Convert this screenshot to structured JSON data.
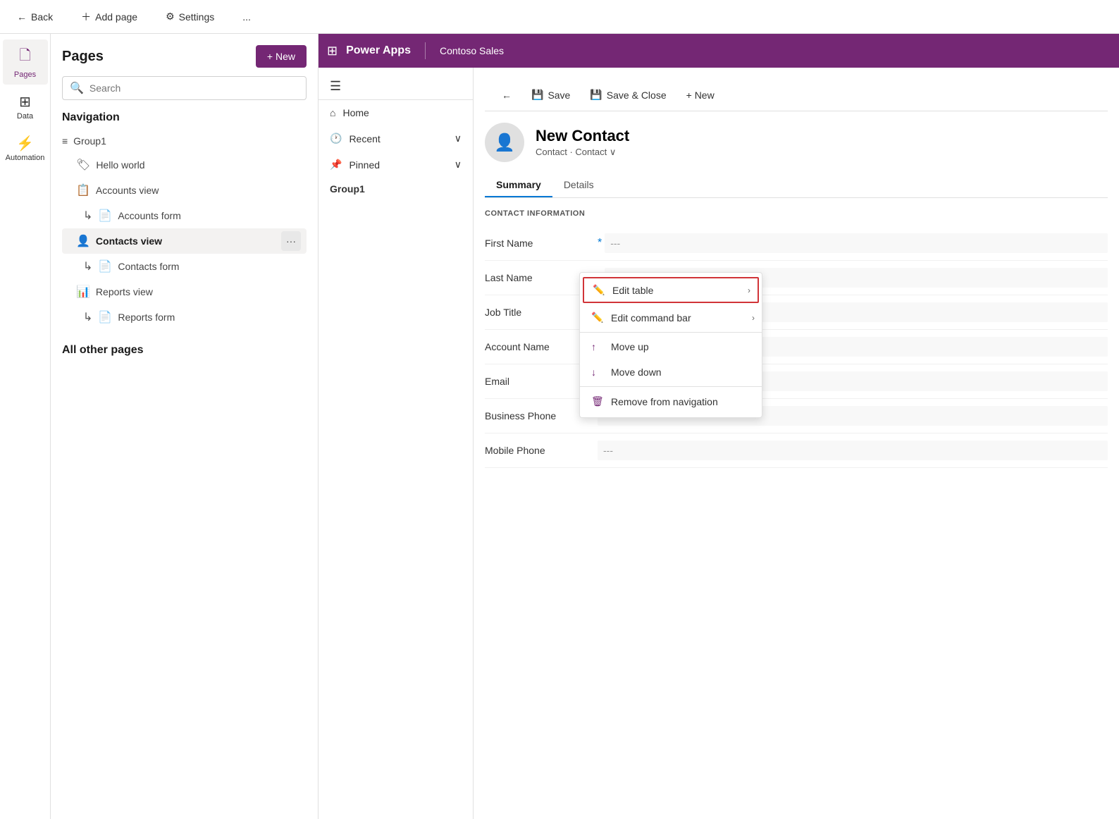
{
  "topbar": {
    "back_label": "Back",
    "add_page_label": "Add page",
    "settings_label": "Settings",
    "more_label": "..."
  },
  "icon_sidebar": {
    "items": [
      {
        "id": "pages",
        "label": "Pages",
        "icon": "🗋",
        "active": true
      },
      {
        "id": "data",
        "label": "Data",
        "icon": "⊞",
        "active": false
      },
      {
        "id": "automation",
        "label": "Automation",
        "icon": "⚡",
        "active": false
      }
    ]
  },
  "pages_panel": {
    "title": "Pages",
    "new_button": "+ New",
    "search_placeholder": "Search",
    "navigation_title": "Navigation",
    "nav_items": [
      {
        "id": "group1",
        "label": "Group1",
        "icon": "≡",
        "type": "group"
      },
      {
        "id": "hello-world",
        "label": "Hello world",
        "icon": "🏷",
        "indent": true
      },
      {
        "id": "accounts-view",
        "label": "Accounts view",
        "icon": "📋",
        "indent": true
      },
      {
        "id": "accounts-form",
        "label": "Accounts form",
        "icon": "↳📄",
        "indent": true
      },
      {
        "id": "contacts-view",
        "label": "Contacts view",
        "icon": "👤",
        "indent": true,
        "active": true
      },
      {
        "id": "contacts-form",
        "label": "Contacts form",
        "icon": "↳📄",
        "indent": true
      },
      {
        "id": "reports-view",
        "label": "Reports view",
        "icon": "📊",
        "indent": true
      },
      {
        "id": "reports-form",
        "label": "Reports form",
        "icon": "↳📄",
        "indent": true
      }
    ],
    "all_other_title": "All other pages"
  },
  "context_menu": {
    "items": [
      {
        "id": "edit-table",
        "label": "Edit table",
        "icon": "✏️",
        "has_arrow": true,
        "highlighted": true
      },
      {
        "id": "edit-command-bar",
        "label": "Edit command bar",
        "icon": "✏️",
        "has_arrow": true
      },
      {
        "id": "move-up",
        "label": "Move up",
        "icon": "↑"
      },
      {
        "id": "move-down",
        "label": "Move down",
        "icon": "↓"
      },
      {
        "id": "remove",
        "label": "Remove from navigation",
        "icon": "🗑️"
      }
    ]
  },
  "power_apps": {
    "app_icon": "⊞",
    "app_name": "Power Apps",
    "app_subtitle": "Contoso Sales",
    "nav": {
      "home": "Home",
      "recent": "Recent",
      "pinned": "Pinned",
      "group1": "Group1"
    }
  },
  "form": {
    "toolbar": {
      "back_icon": "←",
      "save_label": "Save",
      "save_close_label": "Save & Close",
      "new_label": "+ New"
    },
    "contact": {
      "title": "New Contact",
      "subtitle1": "Contact",
      "subtitle2": "Contact"
    },
    "tabs": [
      {
        "id": "summary",
        "label": "Summary",
        "active": true
      },
      {
        "id": "details",
        "label": "Details",
        "active": false
      }
    ],
    "section_title": "CONTACT INFORMATION",
    "fields": [
      {
        "label": "First Name",
        "value": "---",
        "required": true,
        "required_color": "blue"
      },
      {
        "label": "Last Name",
        "value": "---",
        "required": true,
        "required_color": "red"
      },
      {
        "label": "Job Title",
        "value": "---",
        "required": false
      },
      {
        "label": "Account Name",
        "value": "---",
        "required": false
      },
      {
        "label": "Email",
        "value": "---",
        "required": false
      },
      {
        "label": "Business Phone",
        "value": "---",
        "required": false
      },
      {
        "label": "Mobile Phone",
        "value": "---",
        "required": false
      }
    ]
  },
  "colors": {
    "primary_purple": "#742774",
    "accent_blue": "#0078d4",
    "danger_red": "#d13438",
    "bg_light": "#f3f2f1"
  }
}
